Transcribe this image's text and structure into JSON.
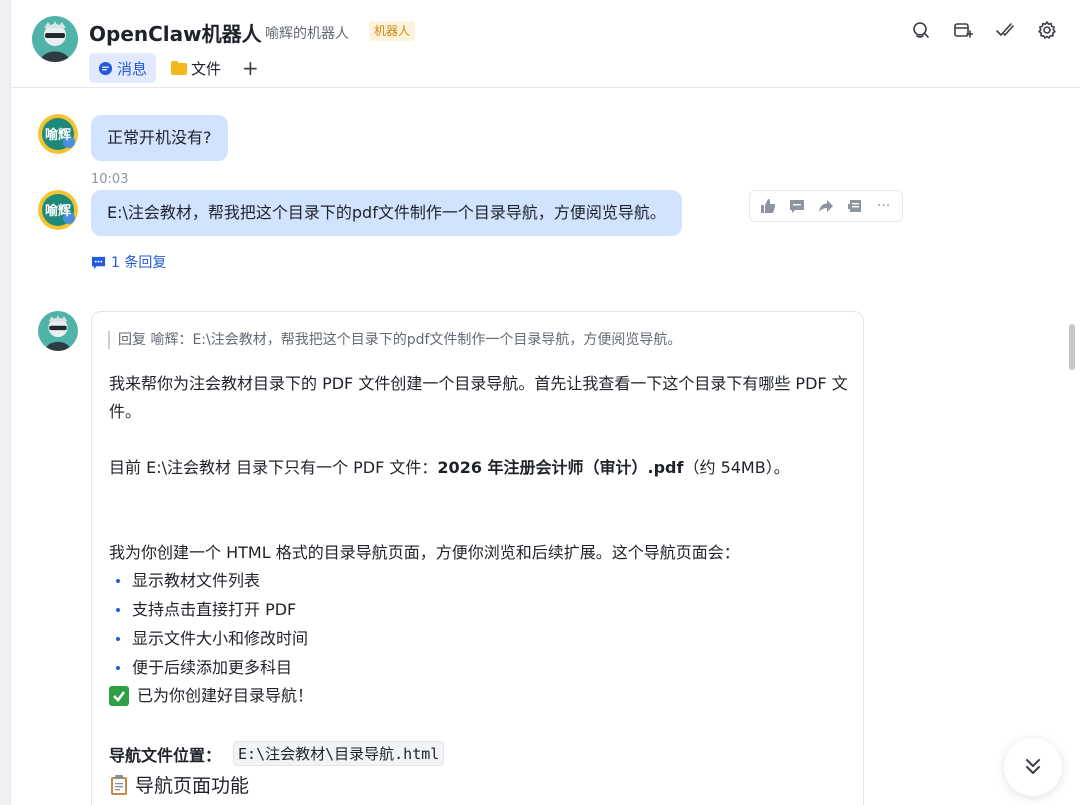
{
  "header": {
    "title": "OpenClaw机器人",
    "subtitle": "喻辉的机器人",
    "badge": "机器人",
    "tabs": [
      {
        "label": "消息",
        "active": true
      },
      {
        "label": "文件",
        "active": false
      }
    ],
    "add_tab": "+"
  },
  "messages": {
    "m1": {
      "text": "正常开机没有?"
    },
    "timestamp": "10:03",
    "m2": {
      "text": "E:\\注会教材，帮我把这个目录下的pdf文件制作一个目录导航，方便阅览导航。"
    },
    "reply_count": "1 条回复",
    "avatar_me_text": "喻辉",
    "more": "···"
  },
  "bot": {
    "quote": "回复 喻辉：E:\\注会教材，帮我把这个目录下的pdf文件制作一个目录导航，方便阅览导航。",
    "para1": "我来帮你为注会教材目录下的 PDF 文件创建一个目录导航。首先让我查看一下这个目录下有哪些 PDF 文件。",
    "para2_pre": "目前 E:\\注会教材 目录下只有一个 PDF 文件：",
    "para2_bold": "2026 年注册会计师（审计）.pdf",
    "para2_post": "（约 54MB）。",
    "para3": "我为你创建一个 HTML 格式的目录导航页面，方便你浏览和后续扩展。这个导航页面会：",
    "bullets": [
      "显示教材文件列表",
      "支持点击直接打开 PDF",
      "显示文件大小和修改时间",
      "便于后续添加更多科目"
    ],
    "done": "已为你创建好目录导航！",
    "location_label": "导航文件位置：",
    "location_path": "E:\\注会教材\\目录导航.html",
    "features_title": "导航页面功能"
  },
  "colors": {
    "accent": "#245bdb",
    "my_bubble": "#d1e3ff",
    "badge_bg": "#fdf3dc",
    "badge_fg": "#d4880f"
  }
}
